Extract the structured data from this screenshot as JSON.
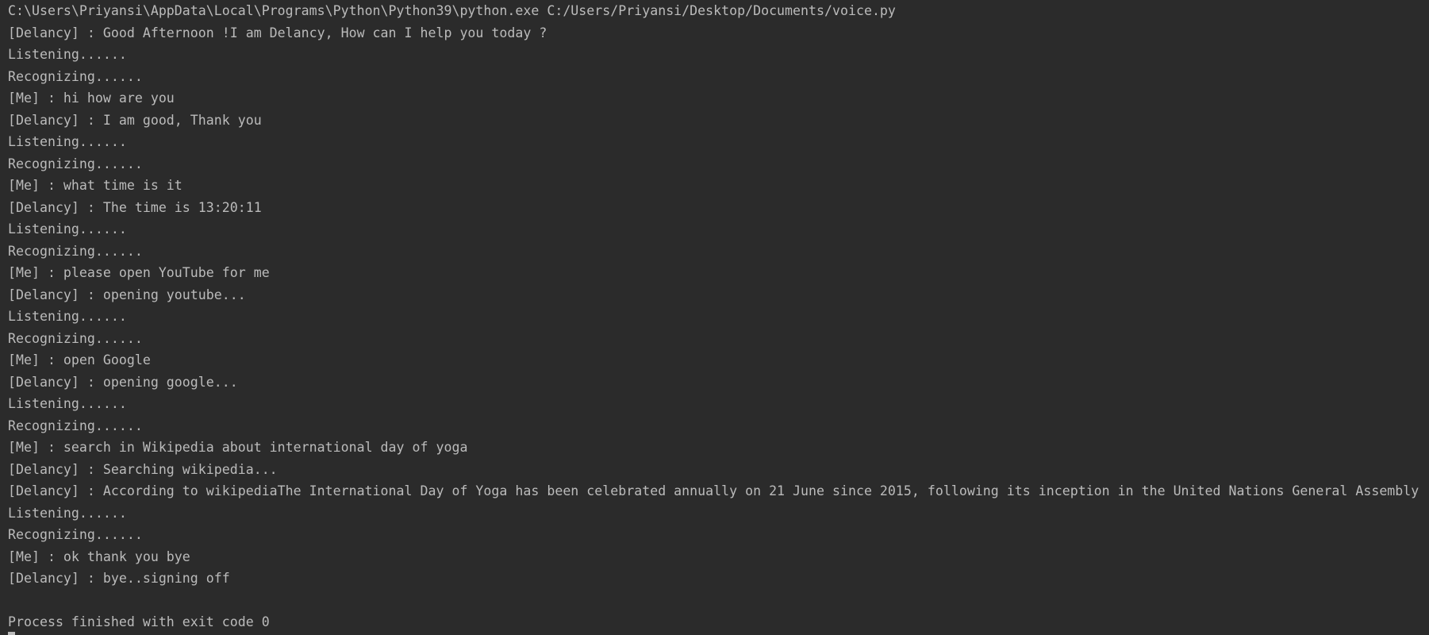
{
  "console": {
    "lines": [
      "C:\\Users\\Priyansi\\AppData\\Local\\Programs\\Python\\Python39\\python.exe C:/Users/Priyansi/Desktop/Documents/voice.py",
      "[Delancy] : Good Afternoon !I am Delancy, How can I help you today ?",
      "Listening......",
      "Recognizing......",
      "[Me] : hi how are you",
      "[Delancy] : I am good, Thank you",
      "Listening......",
      "Recognizing......",
      "[Me] : what time is it",
      "[Delancy] : The time is 13:20:11",
      "Listening......",
      "Recognizing......",
      "[Me] : please open YouTube for me",
      "[Delancy] : opening youtube...",
      "Listening......",
      "Recognizing......",
      "[Me] : open Google",
      "[Delancy] : opening google...",
      "Listening......",
      "Recognizing......",
      "[Me] : search in Wikipedia about international day of yoga",
      "[Delancy] : Searching wikipedia...",
      "[Delancy] : According to wikipediaThe International Day of Yoga has been celebrated annually on 21 June since 2015, following its inception in the United Nations General Assembly",
      "Listening......",
      "Recognizing......",
      "[Me] : ok thank you bye",
      "[Delancy] : bye..signing off",
      "",
      "Process finished with exit code 0"
    ]
  }
}
